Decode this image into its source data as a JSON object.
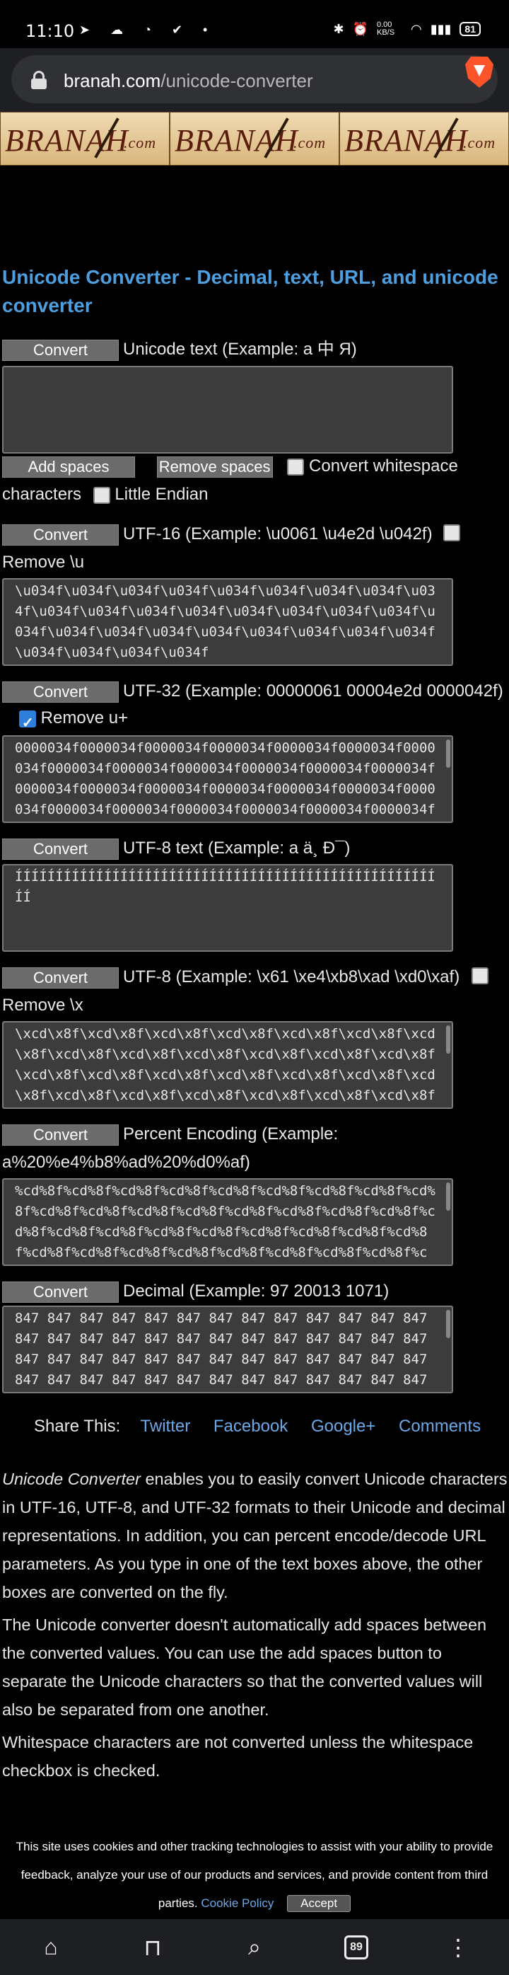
{
  "status_bar": {
    "time": "11:10",
    "speed": "0.00 KB/S",
    "battery": "81"
  },
  "browser": {
    "url_host": "branah.com",
    "url_path": "/unicode-converter",
    "tab_count": "89"
  },
  "banner": {
    "logo_text": "BRANAH",
    "logo_suffix": ".com"
  },
  "page": {
    "title": "Unicode Converter - Decimal, text, URL, and unicode converter",
    "convert_label": "Convert",
    "unicode_text_label": "Unicode text (Example: a 中 Я)",
    "unicode_text_value": "",
    "add_spaces": "Add spaces",
    "remove_spaces": "Remove spaces",
    "convert_whitespace": "Convert whitespace",
    "characters": "characters",
    "little_endian": "Little Endian",
    "utf16_label": "UTF-16 (Example: \\u0061 \\u4e2d \\u042f)",
    "remove_u": "Remove \\u",
    "utf16_value": "\\u034f\\u034f\\u034f\\u034f\\u034f\\u034f\\u034f\\u034f\\u034f\\u034f\\u034f\\u034f\\u034f\\u034f\\u034f\\u034f\\u034f\\u034f\\u034f\\u034f\\u034f\\u034f\\u034f\\u034f\\u034f\\u034f\\u034f\\u034f\\u034f\\u034f",
    "utf32_label": "UTF-32 (Example: 00000061 00004e2d 0000042f)",
    "remove_uplus": "Remove u+",
    "utf32_value": "0000034f0000034f0000034f0000034f0000034f0000034f0000034f0000034f0000034f0000034f0000034f0000034f0000034f0000034f0000034f0000034f0000034f0000034f0000034f0000034f0000034f0000034f0000034f0000034f0000034f0000034f",
    "utf8_text_label": "UTF-8 text (Example: a ä¸­ Ð¯)",
    "utf8_text_value": "ÍÍÍÍÍÍÍÍÍÍÍÍÍÍÍÍÍÍÍÍÍÍÍÍÍÍÍÍÍÍÍÍÍÍÍÍÍÍÍÍÍÍÍÍÍÍÍÍÍÍÍÍÍÍ",
    "utf8_label": "UTF-8 (Example: \\x61 \\xe4\\xb8\\xad \\xd0\\xaf)",
    "remove_x": "Remove \\x",
    "utf8_value": "\\xcd\\x8f\\xcd\\x8f\\xcd\\x8f\\xcd\\x8f\\xcd\\x8f\\xcd\\x8f\\xcd\\x8f\\xcd\\x8f\\xcd\\x8f\\xcd\\x8f\\xcd\\x8f\\xcd\\x8f\\xcd\\x8f\\xcd\\x8f\\xcd\\x8f\\xcd\\x8f\\xcd\\x8f\\xcd\\x8f\\xcd\\x8f\\xcd\\x8f\\xcd\\x8f\\xcd\\x8f\\xcd\\x8f\\xcd\\x8f\\xcd\\x8f\\xcd\\x8f\\xcd\\x8f\\xcd\\x8f\\xcd\\x8f\\xcd\\x8f",
    "percent_label": "Percent Encoding (Example:",
    "percent_label2": "a%20%e4%b8%ad%20%d0%af)",
    "percent_value": "%cd%8f%cd%8f%cd%8f%cd%8f%cd%8f%cd%8f%cd%8f%cd%8f%cd%8f%cd%8f%cd%8f%cd%8f%cd%8f%cd%8f%cd%8f%cd%8f%cd%8f%cd%8f%cd%8f%cd%8f%cd%8f%cd%8f%cd%8f%cd%8f%cd%8f%cd%8f%cd%8f%cd%8f%cd%8f%cd%8f%cd%8f%cd%8f%cd%8f%cd%8f%cd%8f",
    "decimal_label": "Decimal (Example: 97 20013 1071)",
    "decimal_value": "847 847 847 847 847 847 847 847 847 847 847 847 847 847 847 847 847 847 847 847 847 847 847 847 847 847 847 847 847 847 847 847 847 847 847 847 847 847 847 847 847 847 847 847 847 847 847 847 847 847 847 847 847 847 847 847 847 847 847 847 847",
    "share_label": "Share This:",
    "share_links": [
      "Twitter",
      "Facebook",
      "Google+",
      "Comments"
    ],
    "para1_em": "Unicode Converter",
    "para1": " enables you to easily convert Unicode characters in UTF-16, UTF-8, and UTF-32 formats to their Unicode and decimal representations. In addition, you can percent encode/decode URL parameters. As you type in one of the text boxes above, the other boxes are converted on the fly.",
    "para2": "The Unicode converter doesn't automatically add spaces between the converted values. You can use the add spaces button to separate the Unicode characters so that the converted values will also be separated from one another.",
    "para3": "Whitespace characters are not converted unless the whitespace checkbox is checked."
  },
  "cookie": {
    "text": "This site uses cookies and other tracking technologies to assist with your ability to provide feedback, analyze your use of our products and services, and provide content from third parties.",
    "policy": "Cookie Policy",
    "accept": "Accept"
  },
  "icons": [
    "home-icon",
    "bookmark-icon",
    "search-icon",
    "tabs-icon",
    "menu-icon"
  ]
}
